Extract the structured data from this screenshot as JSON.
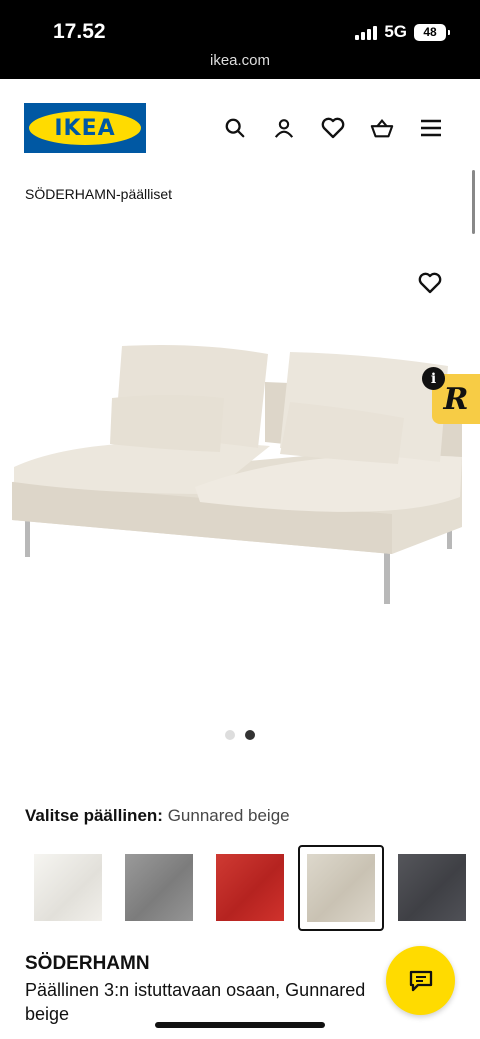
{
  "status": {
    "time": "17.52",
    "network": "5G",
    "battery": "48",
    "url": "ikea.com"
  },
  "header": {
    "logo_text": "IKEA",
    "icons": [
      "search-icon",
      "account-icon",
      "heart-icon",
      "cart-icon",
      "menu-icon"
    ]
  },
  "breadcrumb": "SÖDERHAMN-päälliset",
  "carousel": {
    "count": 2,
    "active_index": 2
  },
  "extension_badge": {
    "letter": "R",
    "info": "i"
  },
  "cover": {
    "label": "Valitse päällinen:",
    "selected": "Gunnared beige",
    "swatches": [
      {
        "name": "white",
        "color": "#ecebe6"
      },
      {
        "name": "grey",
        "color": "#8c8c8c"
      },
      {
        "name": "red",
        "color": "#c52a25"
      },
      {
        "name": "gunnared-beige",
        "color": "#d6d0c2",
        "selected": true
      },
      {
        "name": "dark-grey",
        "color": "#4a4b50"
      }
    ]
  },
  "product": {
    "name": "SÖDERHAMN",
    "description": "Päällinen 3:n istuttavaan osaan, Gunnared beige"
  },
  "colors": {
    "ikea_blue": "#0058a3",
    "ikea_yellow": "#ffdb00"
  }
}
